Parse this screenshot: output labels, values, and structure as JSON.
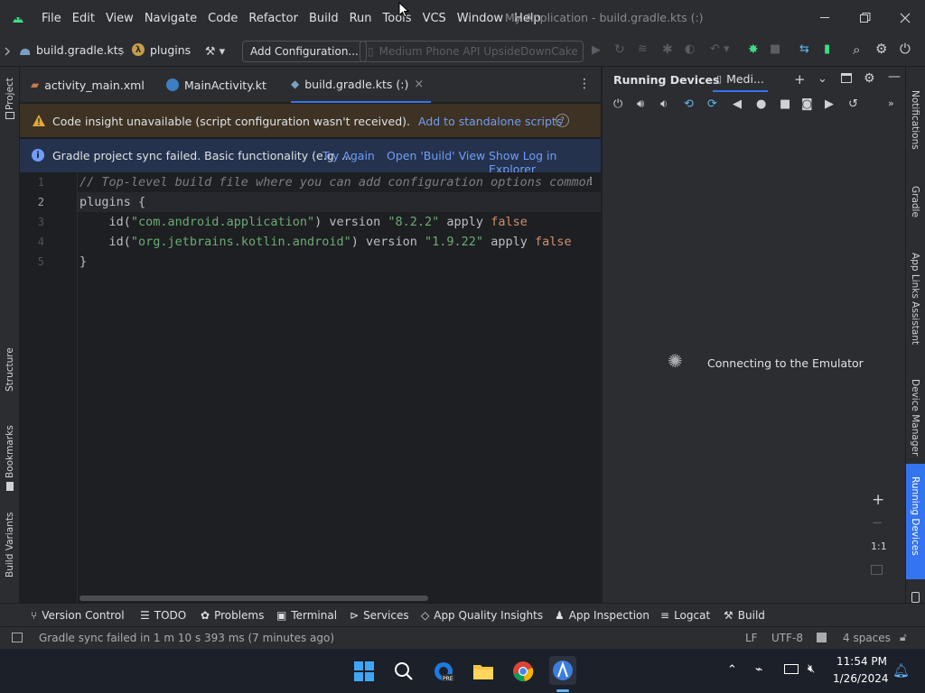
{
  "menu": [
    "File",
    "Edit",
    "View",
    "Navigate",
    "Code",
    "Refactor",
    "Build",
    "Run",
    "Tools",
    "VCS",
    "Window",
    "Help"
  ],
  "window_title": "My Application - build.gradle.kts (:)",
  "breadcrumb": {
    "file": "build.gradle.kts",
    "section": "plugins"
  },
  "toolbar": {
    "add_config": "Add Configuration...",
    "device": "Medium Phone API UpsideDownCake"
  },
  "tabs": [
    {
      "label": "activity_main.xml"
    },
    {
      "label": "MainActivity.kt"
    },
    {
      "label": "build.gradle.kts (:)",
      "close": "×"
    }
  ],
  "warning_banner": {
    "text": "Code insight unavailable (script configuration wasn't received).",
    "link": "Add to standalone scripts",
    "help": "?"
  },
  "info_banner": {
    "text": "Gradle project sync failed. Basic functionality (e.g. ...",
    "links": [
      "Try Again",
      "Open 'Build' View",
      "Show Log in Explorer"
    ]
  },
  "editor": {
    "line_numbers": [
      "1",
      "2",
      "3",
      "4",
      "5"
    ],
    "lines": {
      "l1_comment": "// Top-level build file where you can add configuration options common",
      "l2_kw": "plugins {",
      "l3_id": "    id(",
      "l3_str": "\"com.android.application\"",
      "l3_version": ") version ",
      "l3_ver_str": "\"8.2.2\"",
      "l3_apply": " apply ",
      "l3_false": "false",
      "l4_id": "    id(",
      "l4_str": "\"org.jetbrains.kotlin.android\"",
      "l4_version": ") version ",
      "l4_ver_str": "\"1.9.22\"",
      "l4_apply": " apply ",
      "l4_false": "false",
      "l5": "}"
    }
  },
  "running_devices": {
    "title": "Running Devices",
    "device_tab": "Medi...",
    "status": "Connecting to the Emulator",
    "zoom_reset": "1:1"
  },
  "left_strip": [
    "Project",
    "Structure",
    "Bookmarks",
    "Build Variants"
  ],
  "right_strip": [
    "Notifications",
    "Gradle",
    "App Links Assistant",
    "Device Manager",
    "Running Devices"
  ],
  "bottom_tools": [
    "Version Control",
    "TODO",
    "Problems",
    "Terminal",
    "Services",
    "App Quality Insights",
    "App Inspection",
    "Logcat",
    "Build"
  ],
  "status": {
    "message": "Gradle sync failed in 1 m 10 s 393 ms (7 minutes ago)",
    "line_sep": "LF",
    "encoding": "UTF-8",
    "indent": "4 spaces"
  },
  "taskbar": {
    "time": "11:54 PM",
    "date": "1/26/2024"
  },
  "colors": {
    "accent": "#3574f0",
    "warning_bg": "#3d3223",
    "info_bg": "#25324d",
    "string": "#6aab73",
    "keyword": "#cf8e6d"
  }
}
